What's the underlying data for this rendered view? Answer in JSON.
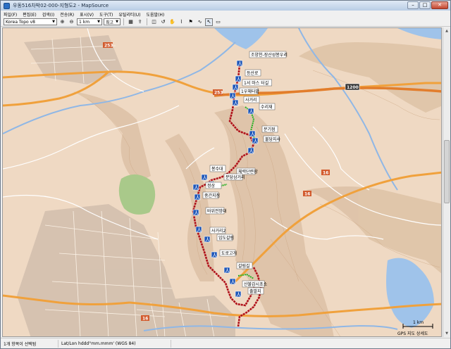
{
  "window": {
    "title": "우동516차박02-000-지형도2 - MapSource"
  },
  "menu": [
    "파일(F)",
    "편집(E)",
    "검색(I)",
    "전송(R)",
    "표시(V)",
    "도구(T)",
    "유틸리티(U)",
    "도움말(H)"
  ],
  "toolbar": {
    "map_product": "Korea Topo v8",
    "scale": "1 km",
    "detail": "최고",
    "tools": [
      "zoom-in-icon",
      "zoom-out-icon",
      "pointer-icon",
      "hand-icon",
      "route-icon",
      "flag-icon",
      "track-icon",
      "select-icon",
      "measure-icon"
    ]
  },
  "map": {
    "road_shields": [
      "253",
      "253",
      "1200",
      "16",
      "16",
      "16"
    ],
    "waypoints": [
      {
        "label": "조양천-장산성봉우리"
      },
      {
        "label": "등산로"
      },
      {
        "label": "1서 마스 터길"
      },
      {
        "label": "1우체터밭"
      },
      {
        "label": "사거리"
      },
      {
        "label": "수리재"
      },
      {
        "label": "분기점"
      },
      {
        "label": "불당지사"
      },
      {
        "label": "체력단련장"
      },
      {
        "label": "봉수대"
      },
      {
        "label": "분당삼거리"
      },
      {
        "label": "정상"
      },
      {
        "label": "중간지점"
      },
      {
        "label": "바위전망대"
      },
      {
        "label": "사거리2"
      },
      {
        "label": "임도갈림"
      },
      {
        "label": "도로고개"
      },
      {
        "label": "갈림길"
      },
      {
        "label": "산불감시초소"
      },
      {
        "label": "출발지"
      }
    ],
    "scale_label": "1 km",
    "copyright": "GPS 지도 상세도"
  },
  "status": {
    "selection": "1개 항목이 선택됨",
    "coord_format": "Lat/Lon hddd°mm.mmm' (WGS 84)"
  }
}
